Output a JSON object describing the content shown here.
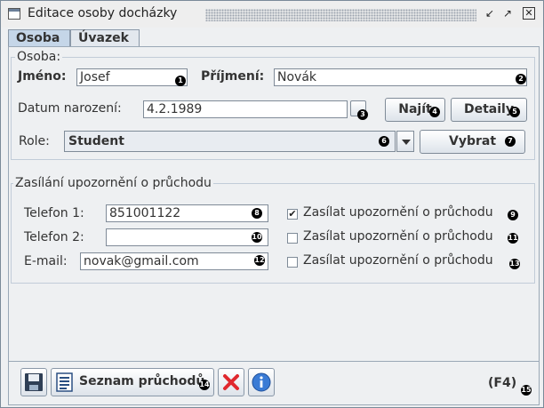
{
  "window": {
    "title": "Editace osoby docházky"
  },
  "tabs": [
    {
      "label": "Osoba"
    },
    {
      "label": "Úvazek"
    }
  ],
  "person_group": {
    "title": "Osoba:",
    "first_name_label": "Jméno:",
    "first_name_value": "Josef",
    "last_name_label": "Příjmení:",
    "last_name_value": "Novák",
    "birth_date_label": "Datum narození:",
    "birth_date_value": "4.2.1989",
    "find_label": "Najít",
    "details_label": "Detaily",
    "role_label": "Role:",
    "role_value": "Student",
    "select_label": "Vybrat"
  },
  "notify_group": {
    "title": "Zasílání upozornění o průchodu",
    "phone1_label": "Telefon 1:",
    "phone1_value": "851001122",
    "phone2_label": "Telefon 2:",
    "phone2_value": "",
    "email_label": "E-mail:",
    "email_value": "novak@gmail.com",
    "check1_label": "Zasílat upozornění o průchodu",
    "check1_checked": true,
    "check2_label": "Zasílat upozornění o průchodu",
    "check2_checked": false,
    "check3_label": "Zasílat upozornění o průchodu",
    "check3_checked": false
  },
  "toolbar": {
    "passages_label": "Seznam průchodů",
    "shortcut": "(F4)"
  },
  "badges": [
    "1",
    "2",
    "3",
    "4",
    "5",
    "6",
    "7",
    "8",
    "9",
    "10",
    "11",
    "12",
    "13",
    "14",
    "15"
  ],
  "icons": [
    "window-icon",
    "minimize-icon",
    "maximize-icon",
    "close-icon",
    "calendar-icon",
    "dropdown-arrow-icon",
    "checkmark-icon",
    "save-icon",
    "list-icon",
    "delete-icon",
    "info-icon"
  ]
}
